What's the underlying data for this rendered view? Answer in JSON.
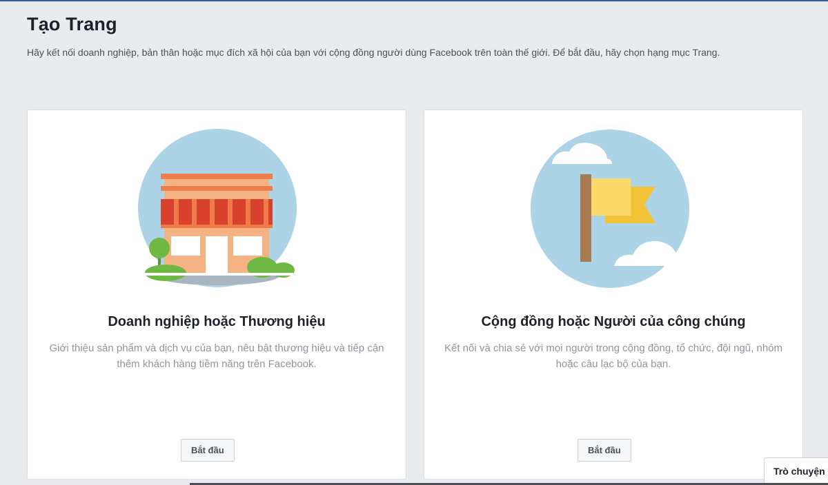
{
  "page": {
    "title": "Tạo Trang",
    "description": "Hãy kết nối doanh nghiệp, bản thân hoặc mục đích xã hội của bạn với cộng đồng người dùng Facebook trên toàn thế giới. Để bắt đầu, hãy chọn hạng mục Trang."
  },
  "cards": [
    {
      "icon": "storefront-icon",
      "title": "Doanh nghiệp hoặc Thương hiệu",
      "description": "Giới thiệu sản phẩm và dịch vụ của bạn, nêu bật thương hiệu và tiếp cận thêm khách hàng tiềm năng trên Facebook.",
      "button_label": "Bắt đầu"
    },
    {
      "icon": "flag-icon",
      "title": "Cộng đồng hoặc Người của công chúng",
      "description": "Kết nối và chia sẻ với mọi người trong cộng đồng, tổ chức, đội ngũ, nhóm hoặc câu lạc bộ của bạn.",
      "button_label": "Bắt đầu"
    }
  ],
  "chat": {
    "label": "Trò chuyện"
  },
  "colors": {
    "accent": "#3b5998",
    "background": "#e9ebee",
    "circle": "#add4e6",
    "awning_red": "#d8412c",
    "storefront": "#f5b282",
    "flag_yellow": "#fcd96a",
    "tree_green": "#6fb843"
  }
}
